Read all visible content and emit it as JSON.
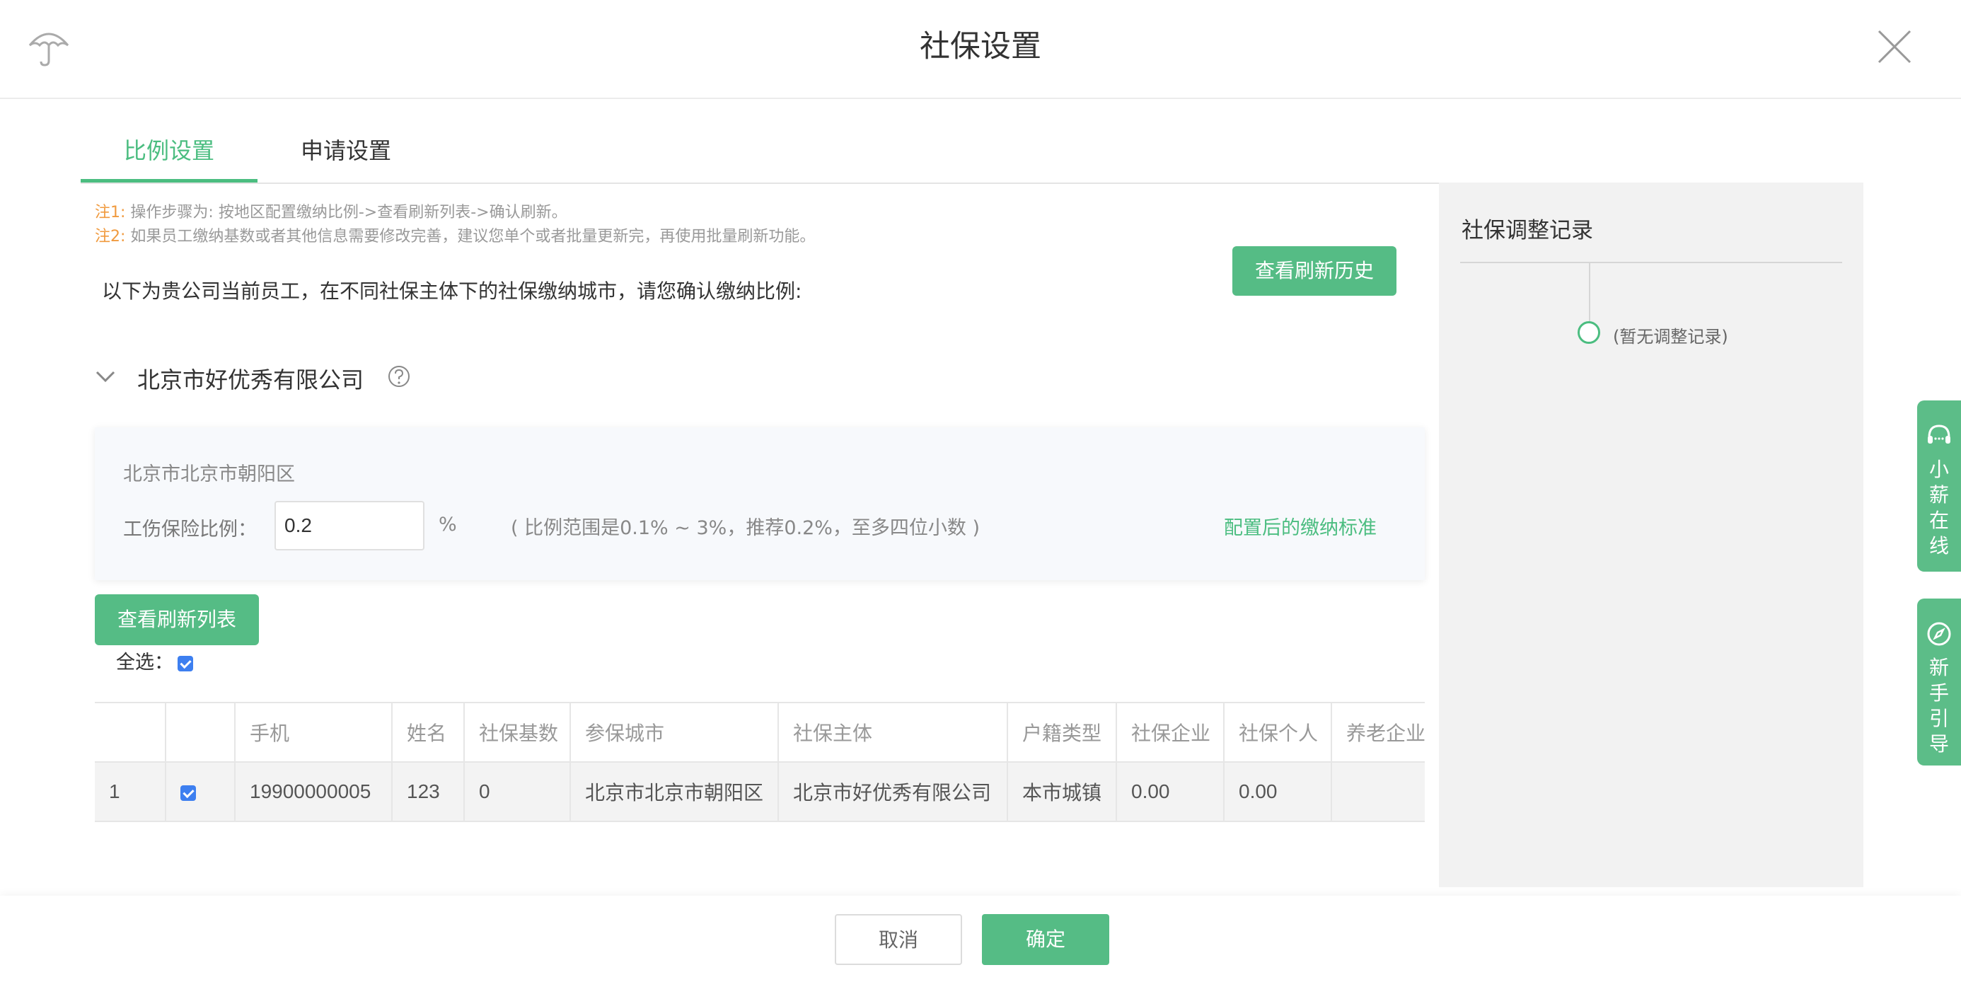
{
  "header": {
    "title": "社保设置",
    "logo_icon": "umbrella-icon",
    "close_icon": "close-icon"
  },
  "tabs": [
    {
      "label": "比例设置",
      "active": true
    },
    {
      "label": "申请设置",
      "active": false
    }
  ],
  "notes": {
    "note1_prefix": "注1:",
    "note1_text": " 操作步骤为: 按地区配置缴纳比例->查看刷新列表->确认刷新。",
    "note2_prefix": "注2:",
    "note2_text": " 如果员工缴纳基数或者其他信息需要修改完善，建议您单个或者批量更新完，再使用批量刷新功能。"
  },
  "intro": "以下为贵公司当前员工，在不同社保主体下的社保缴纳城市，请您确认缴纳比例:",
  "history_button": "查看刷新历史",
  "company": {
    "name": "北京市好优秀有限公司"
  },
  "city_box": {
    "city": "北京市北京市朝阳区",
    "rate_label": "工伤保险比例：",
    "rate_value": "0.2",
    "unit": "%",
    "range_hint": "( 比例范围是0.1% ~ 3%，推荐0.2%，至多四位小数 )",
    "standard_link": "配置后的缴纳标准"
  },
  "refresh_button": "查看刷新列表",
  "select_all_label": "全选：",
  "table": {
    "headers": [
      "",
      "",
      "手机",
      "姓名",
      "社保基数",
      "参保城市",
      "社保主体",
      "户籍类型",
      "社保企业",
      "社保个人",
      "养老企业"
    ],
    "rows": [
      {
        "index": "1",
        "phone": "19900000005",
        "name": "123",
        "base": "0",
        "city": "北京市北京市朝阳区",
        "entity": "北京市好优秀有限公司",
        "hukou": "本市城镇",
        "company": "0.00",
        "personal": "0.00",
        "pension": ""
      }
    ]
  },
  "side": {
    "title": "社保调整记录",
    "empty": "(暂无调整记录)"
  },
  "floats": {
    "online": "小薪在线",
    "guide": "新手引导"
  },
  "footer": {
    "cancel": "取消",
    "ok": "确定"
  },
  "colors": {
    "accent": "#4bbd80",
    "button": "#55bc85",
    "note_prefix": "#f09a3e",
    "checkbox": "#3d7ff0"
  }
}
